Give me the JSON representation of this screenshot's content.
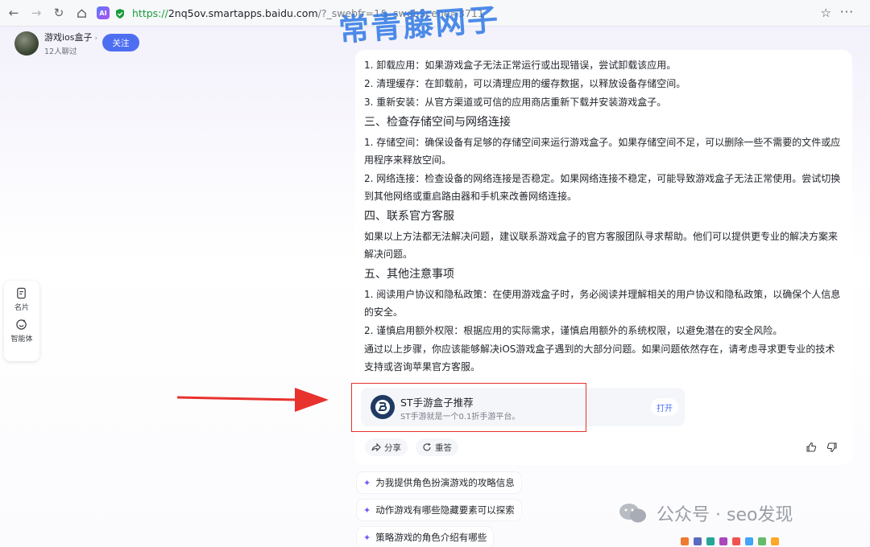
{
  "browser": {
    "url_proto": "https://",
    "url_host": "2nq5ov.smartapps.baidu.com",
    "url_rest": "/?_swebfr=1&_swebScene=3711",
    "watermark": "常青藤网子"
  },
  "profile": {
    "name": "游戏ios盒子",
    "subtitle": "12人聊过",
    "follow_label": "关注"
  },
  "side_panel": {
    "items": [
      {
        "label": "名片",
        "icon": "card-icon"
      },
      {
        "label": "智能体",
        "icon": "agent-icon"
      }
    ]
  },
  "content": {
    "lines": [
      {
        "type": "p",
        "text": "1. 卸载应用：如果游戏盒子无法正常运行或出现错误，尝试卸载该应用。"
      },
      {
        "type": "p",
        "text": "2. 清理缓存：在卸载前，可以清理应用的缓存数据，以释放设备存储空间。"
      },
      {
        "type": "p",
        "text": "3. 重新安装：从官方渠道或可信的应用商店重新下载并安装游戏盒子。"
      },
      {
        "type": "h",
        "text": "三、检查存储空间与网络连接"
      },
      {
        "type": "p",
        "text": "1. 存储空间：确保设备有足够的存储空间来运行游戏盒子。如果存储空间不足，可以删除一些不需要的文件或应用程序来释放空间。"
      },
      {
        "type": "p",
        "text": "2. 网络连接：检查设备的网络连接是否稳定。如果网络连接不稳定，可能导致游戏盒子无法正常使用。尝试切换到其他网络或重启路由器和手机来改善网络连接。"
      },
      {
        "type": "h",
        "text": "四、联系官方客服"
      },
      {
        "type": "p",
        "text": "如果以上方法都无法解决问题，建议联系游戏盒子的官方客服团队寻求帮助。他们可以提供更专业的解决方案来解决问题。"
      },
      {
        "type": "h",
        "text": "五、其他注意事项"
      },
      {
        "type": "p",
        "text": "1. 阅读用户协议和隐私政策：在使用游戏盒子时，务必阅读并理解相关的用户协议和隐私政策，以确保个人信息的安全。"
      },
      {
        "type": "p",
        "text": "2. 谨慎启用额外权限：根据应用的实际需求，谨慎启用额外的系统权限，以避免潜在的安全风险。"
      },
      {
        "type": "p",
        "text": "通过以上步骤，你应该能够解决iOS游戏盒子遇到的大部分问题。如果问题依然存在，请考虑寻求更专业的技术支持或咨询苹果官方客服。"
      }
    ]
  },
  "app_card": {
    "title": "ST手游盒子推荐",
    "desc": "ST手游就是一个0.1折手游平台。",
    "open_label": "打开"
  },
  "actions": {
    "share_label": "分享",
    "regen_label": "重答"
  },
  "suggestions": [
    "为我提供角色扮演游戏的攻略信息",
    "动作游戏有哪些隐藏要素可以探索",
    "策略游戏的角色介绍有哪些"
  ],
  "wechat_watermark": "公众号 · seo发现",
  "colors": {
    "accent": "#4e6ef2",
    "annotation_red": "#e8322e",
    "spark": "#6c5cf6"
  }
}
